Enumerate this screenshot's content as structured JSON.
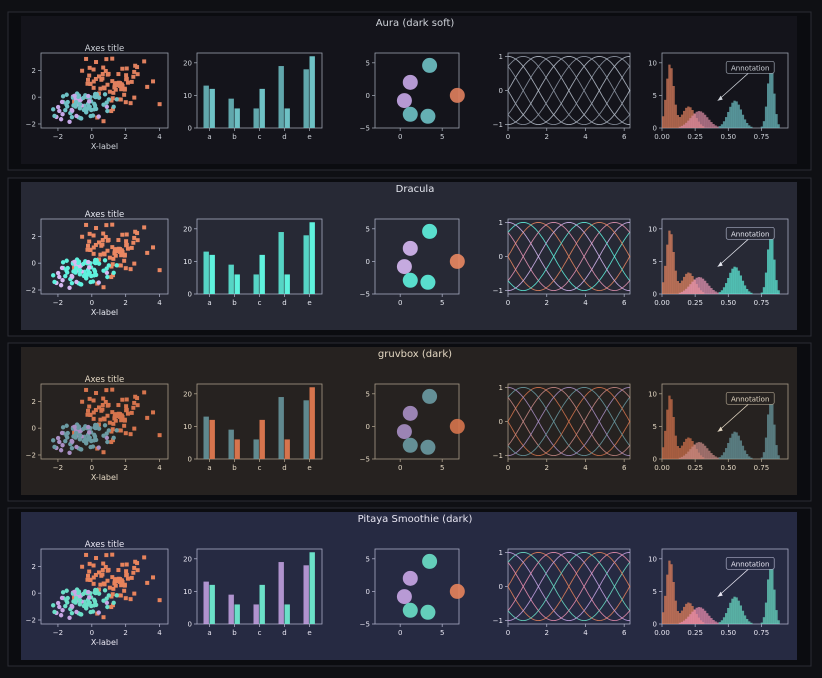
{
  "chart_data": [
    {
      "type": "style-gallery",
      "title": "Aura (dark soft)",
      "colors": {
        "panel_bg": "#14141b",
        "axes_bg": "#14141b",
        "text": "#cfd3da",
        "frame": "#9aa1ad",
        "series": [
          "#e0805e",
          "#6ec1c5",
          "#c7a7e8"
        ],
        "pink": "#d98aa3"
      },
      "scatter": {
        "title": "Axes title",
        "xlabel": "X-label",
        "xlim": [
          -3,
          4.5
        ],
        "ylim": [
          -2.3,
          3.3
        ],
        "xticks": [
          "−2",
          "0",
          "2",
          "4"
        ],
        "yticks": [
          "−2",
          "0",
          "2"
        ]
      },
      "bars": {
        "categories": [
          "a",
          "b",
          "c",
          "d",
          "e"
        ],
        "series": [
          {
            "values": [
              13,
              9,
              6,
              19,
              18
            ]
          },
          {
            "values": [
              12,
              6,
              12,
              6,
              22
            ]
          }
        ],
        "ylim": [
          0,
          23
        ],
        "yticks": [
          "0",
          "10",
          "20"
        ]
      },
      "circles": {
        "xlim": [
          -3,
          7
        ],
        "ylim": [
          -5,
          6.5
        ],
        "xticks": [
          "0",
          "5"
        ],
        "yticks": [
          "−5",
          "0",
          "5"
        ]
      },
      "sines": {
        "xlim": [
          0,
          6.3
        ],
        "ylim": [
          -1.1,
          1.1
        ],
        "xticks": [
          "0",
          "2",
          "4",
          "6"
        ],
        "yticks": [
          "−1",
          "0",
          "1"
        ]
      },
      "hist": {
        "annotation": "Annotation",
        "xlim": [
          0,
          0.95
        ],
        "ylim": [
          0,
          11.5
        ],
        "xticks": [
          "0.00",
          "0.25",
          "0.50",
          "0.75"
        ],
        "yticks": [
          "0",
          "5",
          "10"
        ]
      }
    },
    {
      "type": "style-gallery",
      "title": "Dracula",
      "colors": {
        "panel_bg": "#272935",
        "axes_bg": "#272935",
        "text": "#e6e8f0",
        "frame": "#a6abc0",
        "series": [
          "#ea8762",
          "#5ff2de",
          "#d7b8f2"
        ],
        "pink": "#e895b5"
      },
      "scatter": {
        "title": "Axes title",
        "xlabel": "X-label",
        "xlim": [
          -3,
          4.5
        ],
        "ylim": [
          -2.3,
          3.3
        ],
        "xticks": [
          "−2",
          "0",
          "2",
          "4"
        ],
        "yticks": [
          "−2",
          "0",
          "2"
        ]
      },
      "bars": {
        "categories": [
          "a",
          "b",
          "c",
          "d",
          "e"
        ],
        "series": [
          {
            "values": [
              13,
              9,
              6,
              19,
              18
            ]
          },
          {
            "values": [
              12,
              6,
              12,
              6,
              22
            ]
          }
        ],
        "ylim": [
          0,
          23
        ],
        "yticks": [
          "0",
          "10",
          "20"
        ]
      },
      "circles": {
        "xlim": [
          -3,
          7
        ],
        "ylim": [
          -5,
          6.5
        ],
        "xticks": [
          "0",
          "5"
        ],
        "yticks": [
          "−5",
          "0",
          "5"
        ]
      },
      "sines": {
        "xlim": [
          0,
          6.3
        ],
        "ylim": [
          -1.1,
          1.1
        ],
        "xticks": [
          "0",
          "2",
          "4",
          "6"
        ],
        "yticks": [
          "−1",
          "0",
          "1"
        ]
      },
      "hist": {
        "annotation": "Annotation",
        "xlim": [
          0,
          0.95
        ],
        "ylim": [
          0,
          11.5
        ],
        "xticks": [
          "0.00",
          "0.25",
          "0.50",
          "0.75"
        ],
        "yticks": [
          "0",
          "5",
          "10"
        ]
      }
    },
    {
      "type": "style-gallery",
      "title": "gruvbox (dark)",
      "colors": {
        "panel_bg": "#262220",
        "axes_bg": "#262220",
        "text": "#e3d7c2",
        "frame": "#a89c88",
        "series": [
          "#d6744d",
          "#6b9ba3",
          "#a98fc4"
        ],
        "pink": "#c98a86"
      },
      "scatter": {
        "title": "Axes title",
        "xlabel": "X-label",
        "xlim": [
          -3,
          4.5
        ],
        "ylim": [
          -2.3,
          3.3
        ],
        "xticks": [
          "−2",
          "0",
          "2",
          "4"
        ],
        "yticks": [
          "−2",
          "0",
          "2"
        ]
      },
      "bars": {
        "categories": [
          "a",
          "b",
          "c",
          "d",
          "e"
        ],
        "series": [
          {
            "values": [
              13,
              9,
              6,
              19,
              18
            ]
          },
          {
            "values": [
              12,
              6,
              12,
              6,
              22
            ]
          }
        ],
        "ylim": [
          0,
          23
        ],
        "yticks": [
          "0",
          "10",
          "20"
        ]
      },
      "circles": {
        "xlim": [
          -3,
          7
        ],
        "ylim": [
          -5,
          6.5
        ],
        "xticks": [
          "0",
          "5"
        ],
        "yticks": [
          "−5",
          "0",
          "5"
        ]
      },
      "sines": {
        "xlim": [
          0,
          6.3
        ],
        "ylim": [
          -1.1,
          1.1
        ],
        "xticks": [
          "0",
          "2",
          "4",
          "6"
        ],
        "yticks": [
          "−1",
          "0",
          "1"
        ]
      },
      "hist": {
        "annotation": "Annotation",
        "xlim": [
          0,
          0.95
        ],
        "ylim": [
          0,
          11.5
        ],
        "xticks": [
          "0.00",
          "0.25",
          "0.50",
          "0.75"
        ],
        "yticks": [
          "0",
          "5",
          "10"
        ]
      }
    },
    {
      "type": "style-gallery",
      "title": "Pitaya Smoothie (dark)",
      "colors": {
        "panel_bg": "#262a42",
        "axes_bg": "#262a42",
        "text": "#e8e6f2",
        "frame": "#a9abc4",
        "series": [
          "#e8835c",
          "#6be0c8",
          "#c9a6e6"
        ],
        "pink": "#ec8fb0"
      },
      "scatter": {
        "title": "Axes title",
        "xlabel": "X-label",
        "xlim": [
          -3,
          4.5
        ],
        "ylim": [
          -2.3,
          3.3
        ],
        "xticks": [
          "−2",
          "0",
          "2",
          "4"
        ],
        "yticks": [
          "−2",
          "0",
          "2"
        ]
      },
      "bars": {
        "categories": [
          "a",
          "b",
          "c",
          "d",
          "e"
        ],
        "series": [
          {
            "values": [
              13,
              9,
              6,
              19,
              18
            ]
          },
          {
            "values": [
              12,
              6,
              12,
              6,
              22
            ]
          }
        ],
        "ylim": [
          0,
          23
        ],
        "yticks": [
          "0",
          "10",
          "20"
        ]
      },
      "circles": {
        "xlim": [
          -3,
          7
        ],
        "ylim": [
          -5,
          6.5
        ],
        "xticks": [
          "0",
          "5"
        ],
        "yticks": [
          "−5",
          "0",
          "5"
        ]
      },
      "sines": {
        "xlim": [
          0,
          6.3
        ],
        "ylim": [
          -1.1,
          1.1
        ],
        "xticks": [
          "0",
          "2",
          "4",
          "6"
        ],
        "yticks": [
          "−1",
          "0",
          "1"
        ]
      },
      "hist": {
        "annotation": "Annotation",
        "xlim": [
          0,
          0.95
        ],
        "ylim": [
          0,
          11.5
        ],
        "xticks": [
          "0.00",
          "0.25",
          "0.50",
          "0.75"
        ],
        "yticks": [
          "0",
          "5",
          "10"
        ]
      }
    }
  ]
}
